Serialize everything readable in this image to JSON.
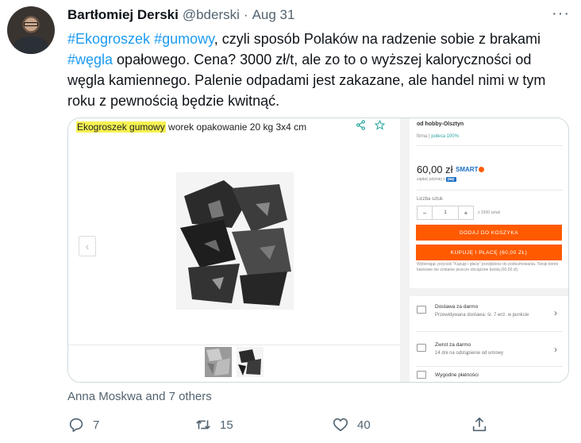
{
  "author": {
    "name": "Bartłomiej Derski",
    "handle": "@bderski",
    "separator": "·",
    "date": "Aug 31"
  },
  "more_icon": "more-horizontal-icon",
  "text": {
    "tag1": "#Ekogroszek",
    "tag2": "#gumowy",
    "part1": ", czyli sposób Polaków na radzenie sobie z brakami ",
    "tag3": "#węgla",
    "part2": " opałowego. Cena? 3000 zł/t, ale zo to o wyższej kaloryczności od węgla kamiennego. Palenie odpadami jest zakazane, ale handel nimi w tym roku z pewnością będzie kwitnąć."
  },
  "media": {
    "title_highlight": "Ekogroszek gumowy",
    "title_rest": " worek opakowanie 20 kg 3x4 cm",
    "prev_glyph": "‹",
    "seller": {
      "name": "od hobby-Olsztyn",
      "type": "firma",
      "sep": " | ",
      "recommend": "poleca 100%"
    },
    "price": "60,00 zł",
    "smart": "SMART",
    "pay_later": "zapłać później z",
    "pay_badge": "pay",
    "qty_label": "Liczba sztuk",
    "qty_minus": "−",
    "qty_value": "1",
    "qty_plus": "+",
    "qty_of": "z 1000 sztuk",
    "add_to_cart": "DODAJ DO KOSZYKA",
    "buy_pay": "KUPUJĘ I PŁACĘ (60,00 ZŁ)",
    "note": "Wybierając przycisk \"Kupuję i płacę\" przejdziesz do podsumowania. Twoje konto bankowe nie zostanie jeszcze obciążone kwotą (60,00 zł).",
    "delivery_title": "Dostawa za darmo",
    "delivery_sub": "Przewidywana dostawa: śr. 7 wrz. w punkcie",
    "return_title": "Zwrot za darmo",
    "return_sub": "14 dni na odstąpienie od umowy",
    "payments_title": "Wygodne płatności",
    "chevron": "›"
  },
  "liked_by": "Anna Moskwa and 7 others",
  "actions": {
    "replies": "7",
    "retweets": "15",
    "likes": "40"
  },
  "colors": {
    "accent": "#1d9bf0",
    "muted": "#536471",
    "orange": "#ff5a00",
    "highlight": "#f6f252"
  }
}
